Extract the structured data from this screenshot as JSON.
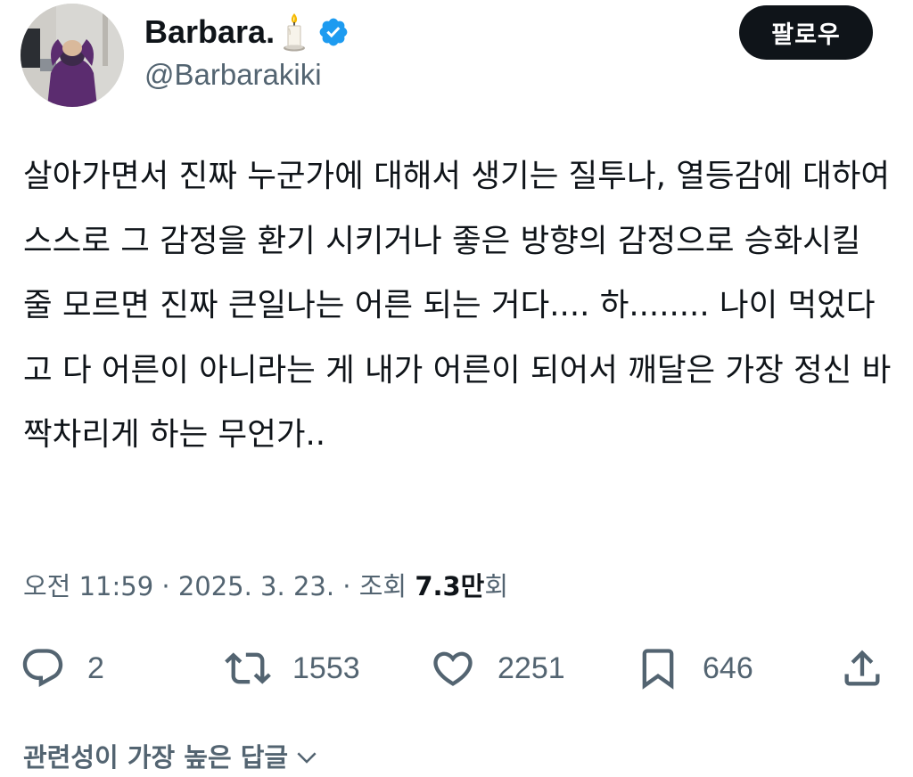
{
  "author": {
    "display_name": "Barbara.",
    "name_emoji": "candle-emoji",
    "verified": "verified-badge-icon",
    "handle": "@Barbarakiki"
  },
  "follow_button": {
    "label": "팔로우"
  },
  "tweet": {
    "text": "살아가면서 진짜 누군가에 대해서 생기는 질투나, 열등감에 대하여 스스로 그 감정을 환기 시키거나 좋은 방향의 감정으로 승화시킬 줄 모르면 진짜 큰일나는 어른 되는 거다.... 하........ 나이 먹었다고 다 어른이 아니라는 게 내가 어른이 되어서 깨달은 가장 정신 바짝차리게 하는 무언가.."
  },
  "meta": {
    "time": "오전 11:59",
    "separator": " · ",
    "date": "2025. 3. 23.",
    "views_label": "조회 ",
    "views_count": "7.3만",
    "views_suffix": "회"
  },
  "actions": {
    "reply": {
      "icon": "reply-icon",
      "count": "2"
    },
    "retweet": {
      "icon": "retweet-icon",
      "count": "1553"
    },
    "like": {
      "icon": "heart-icon",
      "count": "2251"
    },
    "bookmark": {
      "icon": "bookmark-icon",
      "count": "646"
    },
    "share": {
      "icon": "share-icon"
    }
  },
  "replies_sort": {
    "label": "관련성이 가장 높은 답글",
    "icon": "chevron-down-icon"
  },
  "colors": {
    "text_primary": "#0f1419",
    "text_secondary": "#536471",
    "verified_blue": "#1d9bf0",
    "follow_bg": "#0f1419"
  }
}
